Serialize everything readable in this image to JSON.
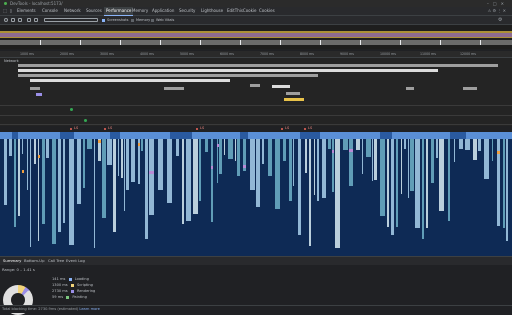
{
  "window": {
    "title": "DevTools - localhost:5173/"
  },
  "tabs": [
    {
      "label": "Elements"
    },
    {
      "label": "Console"
    },
    {
      "label": "Network"
    },
    {
      "label": "Sources"
    },
    {
      "label": "Performance",
      "active": true
    },
    {
      "label": "Memory"
    },
    {
      "label": "Application"
    },
    {
      "label": "Security"
    },
    {
      "label": "Lighthouse"
    },
    {
      "label": "EditThisCookie"
    },
    {
      "label": "Cookies"
    }
  ],
  "toolbar": {
    "screenshots_label": "Screenshots",
    "memory_label": "Memory",
    "webvitals_label": "Web Vitals"
  },
  "ruler": {
    "ticks": [
      "1000 ms",
      "2000 ms",
      "3000 ms",
      "4000 ms",
      "5000 ms",
      "6000 ms",
      "7000 ms",
      "8000 ms",
      "9000 ms",
      "10000 ms",
      "11000 ms",
      "12000 ms"
    ]
  },
  "tracks": {
    "network_label": "Network"
  },
  "markers": [
    {
      "label": "LS"
    },
    {
      "label": "LS"
    },
    {
      "label": "LS"
    },
    {
      "label": "LS"
    },
    {
      "label": "LS"
    }
  ],
  "bottom_tabs": [
    {
      "label": "Summary",
      "active": true
    },
    {
      "label": "Bottom-Up"
    },
    {
      "label": "Call Tree"
    },
    {
      "label": "Event Log"
    }
  ],
  "summary": {
    "range": "Range: 0 – 1.41 s",
    "legend": [
      {
        "value": "141 ms",
        "label": "Loading",
        "color": "#8ab4f8"
      },
      {
        "value": "1300 ms",
        "label": "Scripting",
        "color": "#f1d37a"
      },
      {
        "value": "2730 ms",
        "label": "Rendering",
        "color": "#9b8fe8"
      },
      {
        "value": "59 ms",
        "label": "Painting",
        "color": "#7cc77f"
      }
    ]
  },
  "status": {
    "text": "Total blocking time: 2730.9ms (estimated)",
    "link": "Learn more"
  }
}
